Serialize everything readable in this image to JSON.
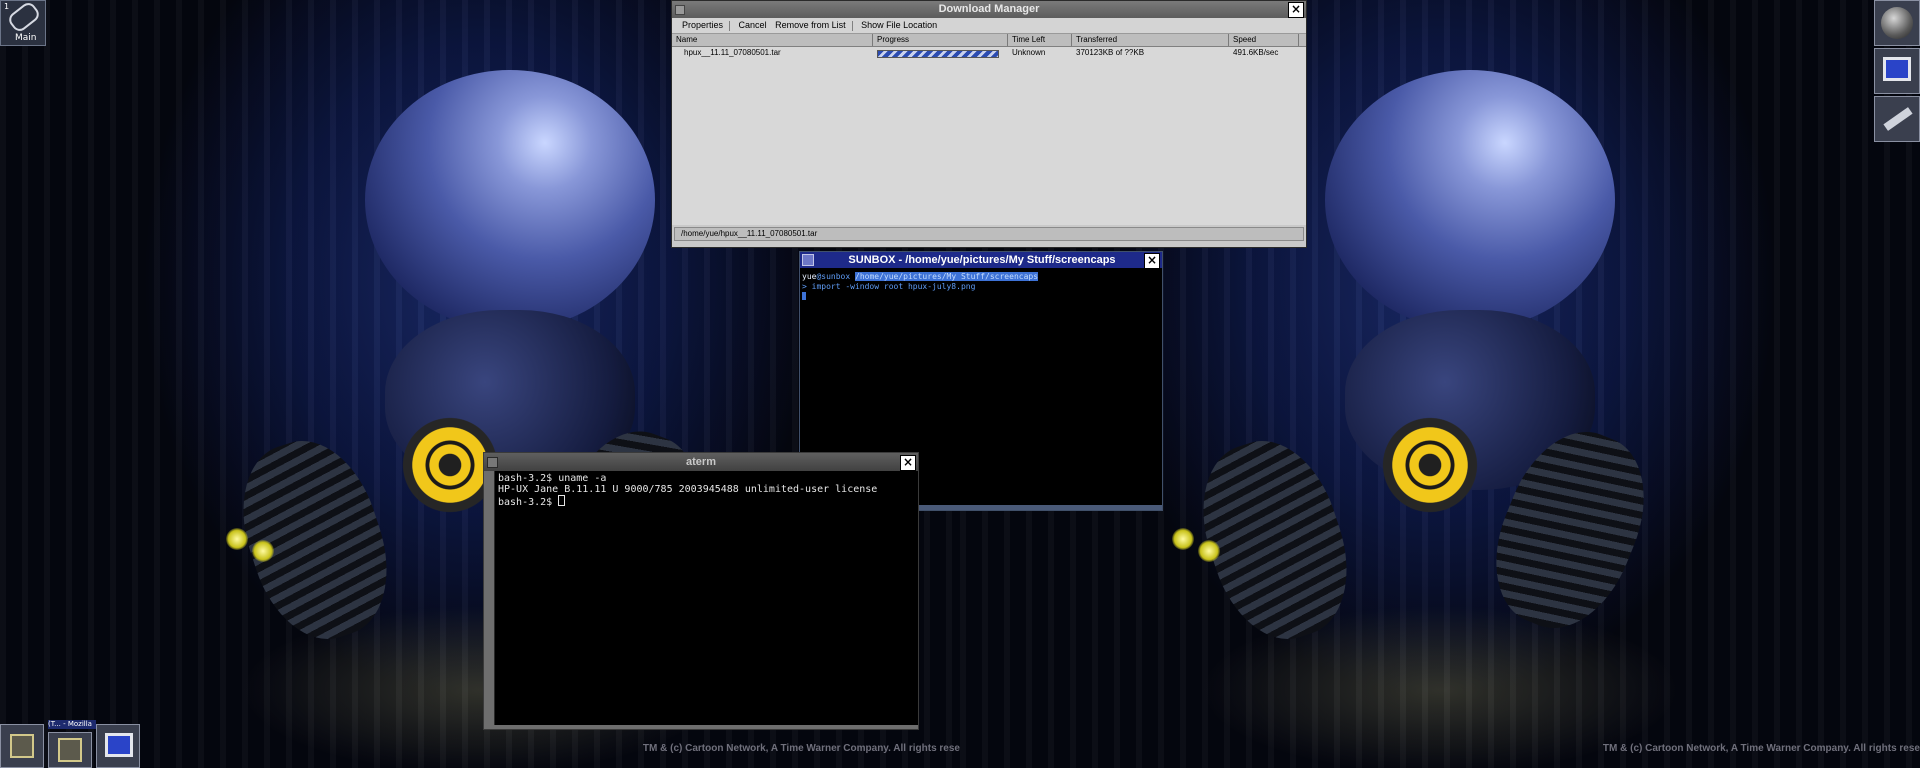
{
  "desktop": {
    "copyright_left": "TM & (c) Cartoon Network, A Time Warner Company. All rights rese",
    "copyright_right": "TM & (c) Cartoon Network, A Time Warner Company. All rights rese",
    "workspace_icon": {
      "number": "1",
      "label": "Main",
      "icon": "paperclip-icon"
    },
    "right_dock": [
      {
        "name": "disc-icon"
      },
      {
        "name": "monitor-icon"
      },
      {
        "name": "tools-icon"
      }
    ],
    "bottom_dock": {
      "mini_title": "(T... - Mozilla",
      "items": [
        {
          "name": "app-icon"
        },
        {
          "name": "app-icon"
        },
        {
          "name": "monitor-icon"
        }
      ]
    }
  },
  "download_manager": {
    "title": "Download Manager",
    "toolbar": {
      "properties": "Properties",
      "cancel": "Cancel",
      "remove": "Remove from List",
      "show_location": "Show File Location"
    },
    "columns": [
      "Name",
      "Progress",
      "Time Left",
      "Transferred",
      "Speed"
    ],
    "rows": [
      {
        "name": "hpux__11.11_07080501.tar",
        "progress_fraction": 0.95,
        "time_left": "Unknown",
        "transferred": "370123KB of ??KB",
        "speed": "491.6KB/sec"
      }
    ],
    "status": "/home/yue/hpux__11.11_07080501.tar"
  },
  "sunbox_terminal": {
    "title": "SUNBOX - /home/yue/pictures/My Stuff/screencaps",
    "user": "yue",
    "host": "@sunbox",
    "path": "/home/yue/pictures/My Stuff/screencaps",
    "command_line": "> import -window root hpux-july8.png"
  },
  "aterm": {
    "title": "aterm",
    "lines": [
      "bash-3.2$ uname -a",
      "HP-UX Jane B.11.11 U 9000/785 2003945488 unlimited-user license",
      "bash-3.2$ "
    ]
  }
}
